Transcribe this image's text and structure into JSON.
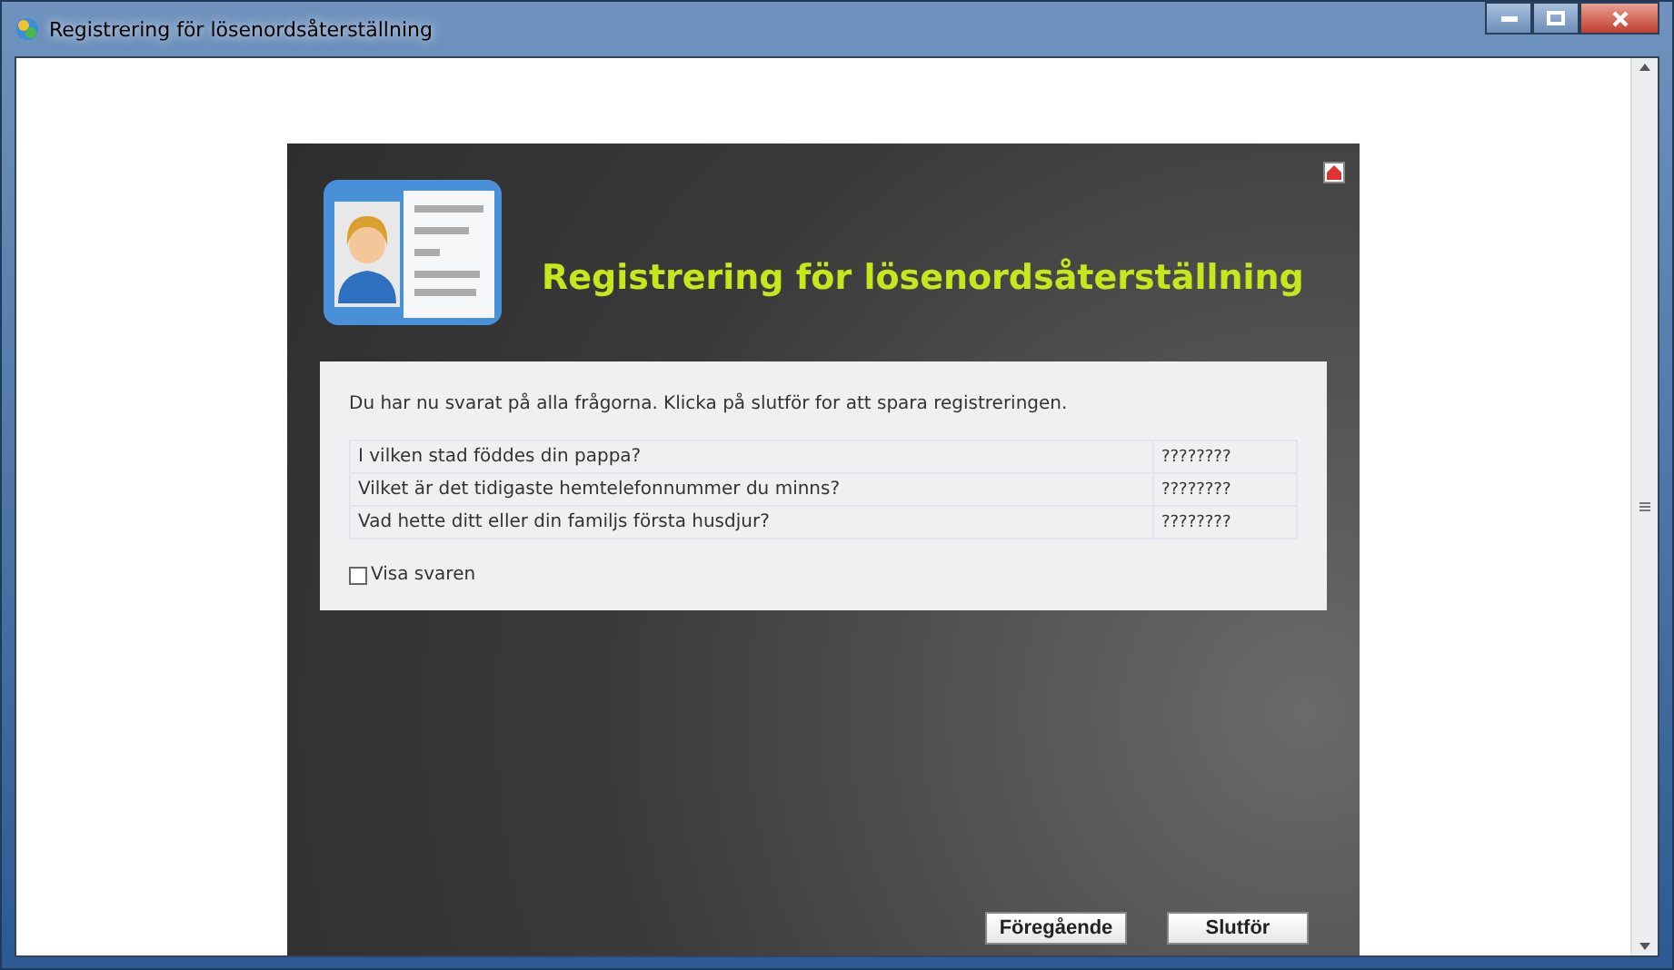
{
  "window": {
    "title": "Registrering för lösenordsåterställning"
  },
  "header": {
    "title": "Registrering för lösenordsåterställning"
  },
  "intro": "Du har nu svarat på alla frågorna. Klicka på slutför for att spara registreringen.",
  "questions": [
    {
      "question": "I vilken stad föddes din pappa?",
      "answer": "????????"
    },
    {
      "question": "Vilket är det tidigaste hemtelefonnummer du minns?",
      "answer": "????????"
    },
    {
      "question": "Vad hette ditt eller din familjs första husdjur?",
      "answer": "????????"
    }
  ],
  "show_answers": {
    "label": "Visa svaren",
    "checked": false
  },
  "buttons": [
    "Föregående",
    "Slutför"
  ]
}
